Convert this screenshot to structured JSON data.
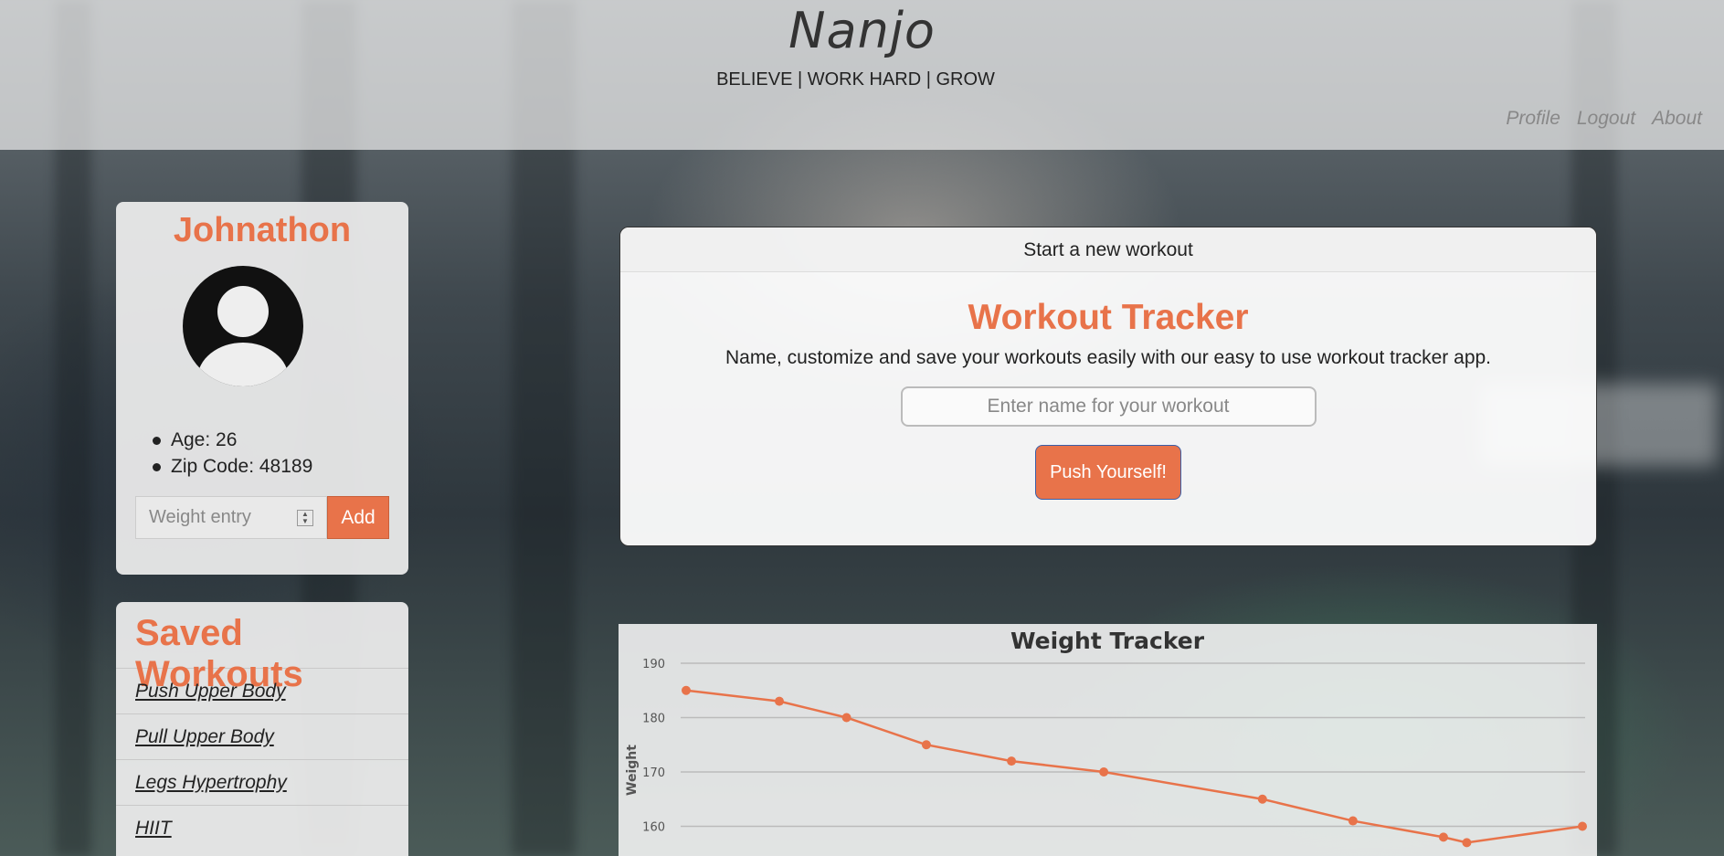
{
  "header": {
    "brand": "Nanjo",
    "tagline": "BELIEVE | WORK HARD | GROW",
    "nav": [
      "Profile",
      "Logout",
      "About"
    ]
  },
  "profile": {
    "name": "Johnathon",
    "facts": [
      "Age: 26",
      "Zip Code: 48189"
    ],
    "weight_placeholder": "Weight entry",
    "add_label": "Add"
  },
  "saved": {
    "title": "Saved Workouts",
    "items": [
      "Push Upper Body",
      "Pull Upper Body",
      "Legs Hypertrophy",
      "HIIT"
    ]
  },
  "tracker": {
    "header": "Start a new workout",
    "title": "Workout Tracker",
    "description": "Name, customize and save your workouts easily with our easy to use workout tracker app.",
    "input_placeholder": "Enter name for your workout",
    "button_label": "Push Yourself!"
  },
  "colors": {
    "accent": "#e8734a",
    "text": "#222222"
  },
  "chart_data": {
    "type": "line",
    "title": "Weight Tracker",
    "ylabel": "Weight",
    "xlabel": "",
    "ylim": [
      155,
      192
    ],
    "yticks": [
      160,
      170,
      180,
      190
    ],
    "grid": true,
    "series": [
      {
        "x": [
          0,
          1,
          2,
          3,
          4,
          5,
          6,
          7,
          8,
          9,
          10
        ],
        "values": [
          185,
          183,
          180,
          175,
          172,
          170,
          165,
          161,
          158,
          157,
          160
        ]
      }
    ],
    "x_positions": [
      0,
      0.104,
      0.179,
      0.268,
      0.363,
      0.466,
      0.643,
      0.744,
      0.845,
      0.871,
      1
    ],
    "color": "#e8734a"
  }
}
